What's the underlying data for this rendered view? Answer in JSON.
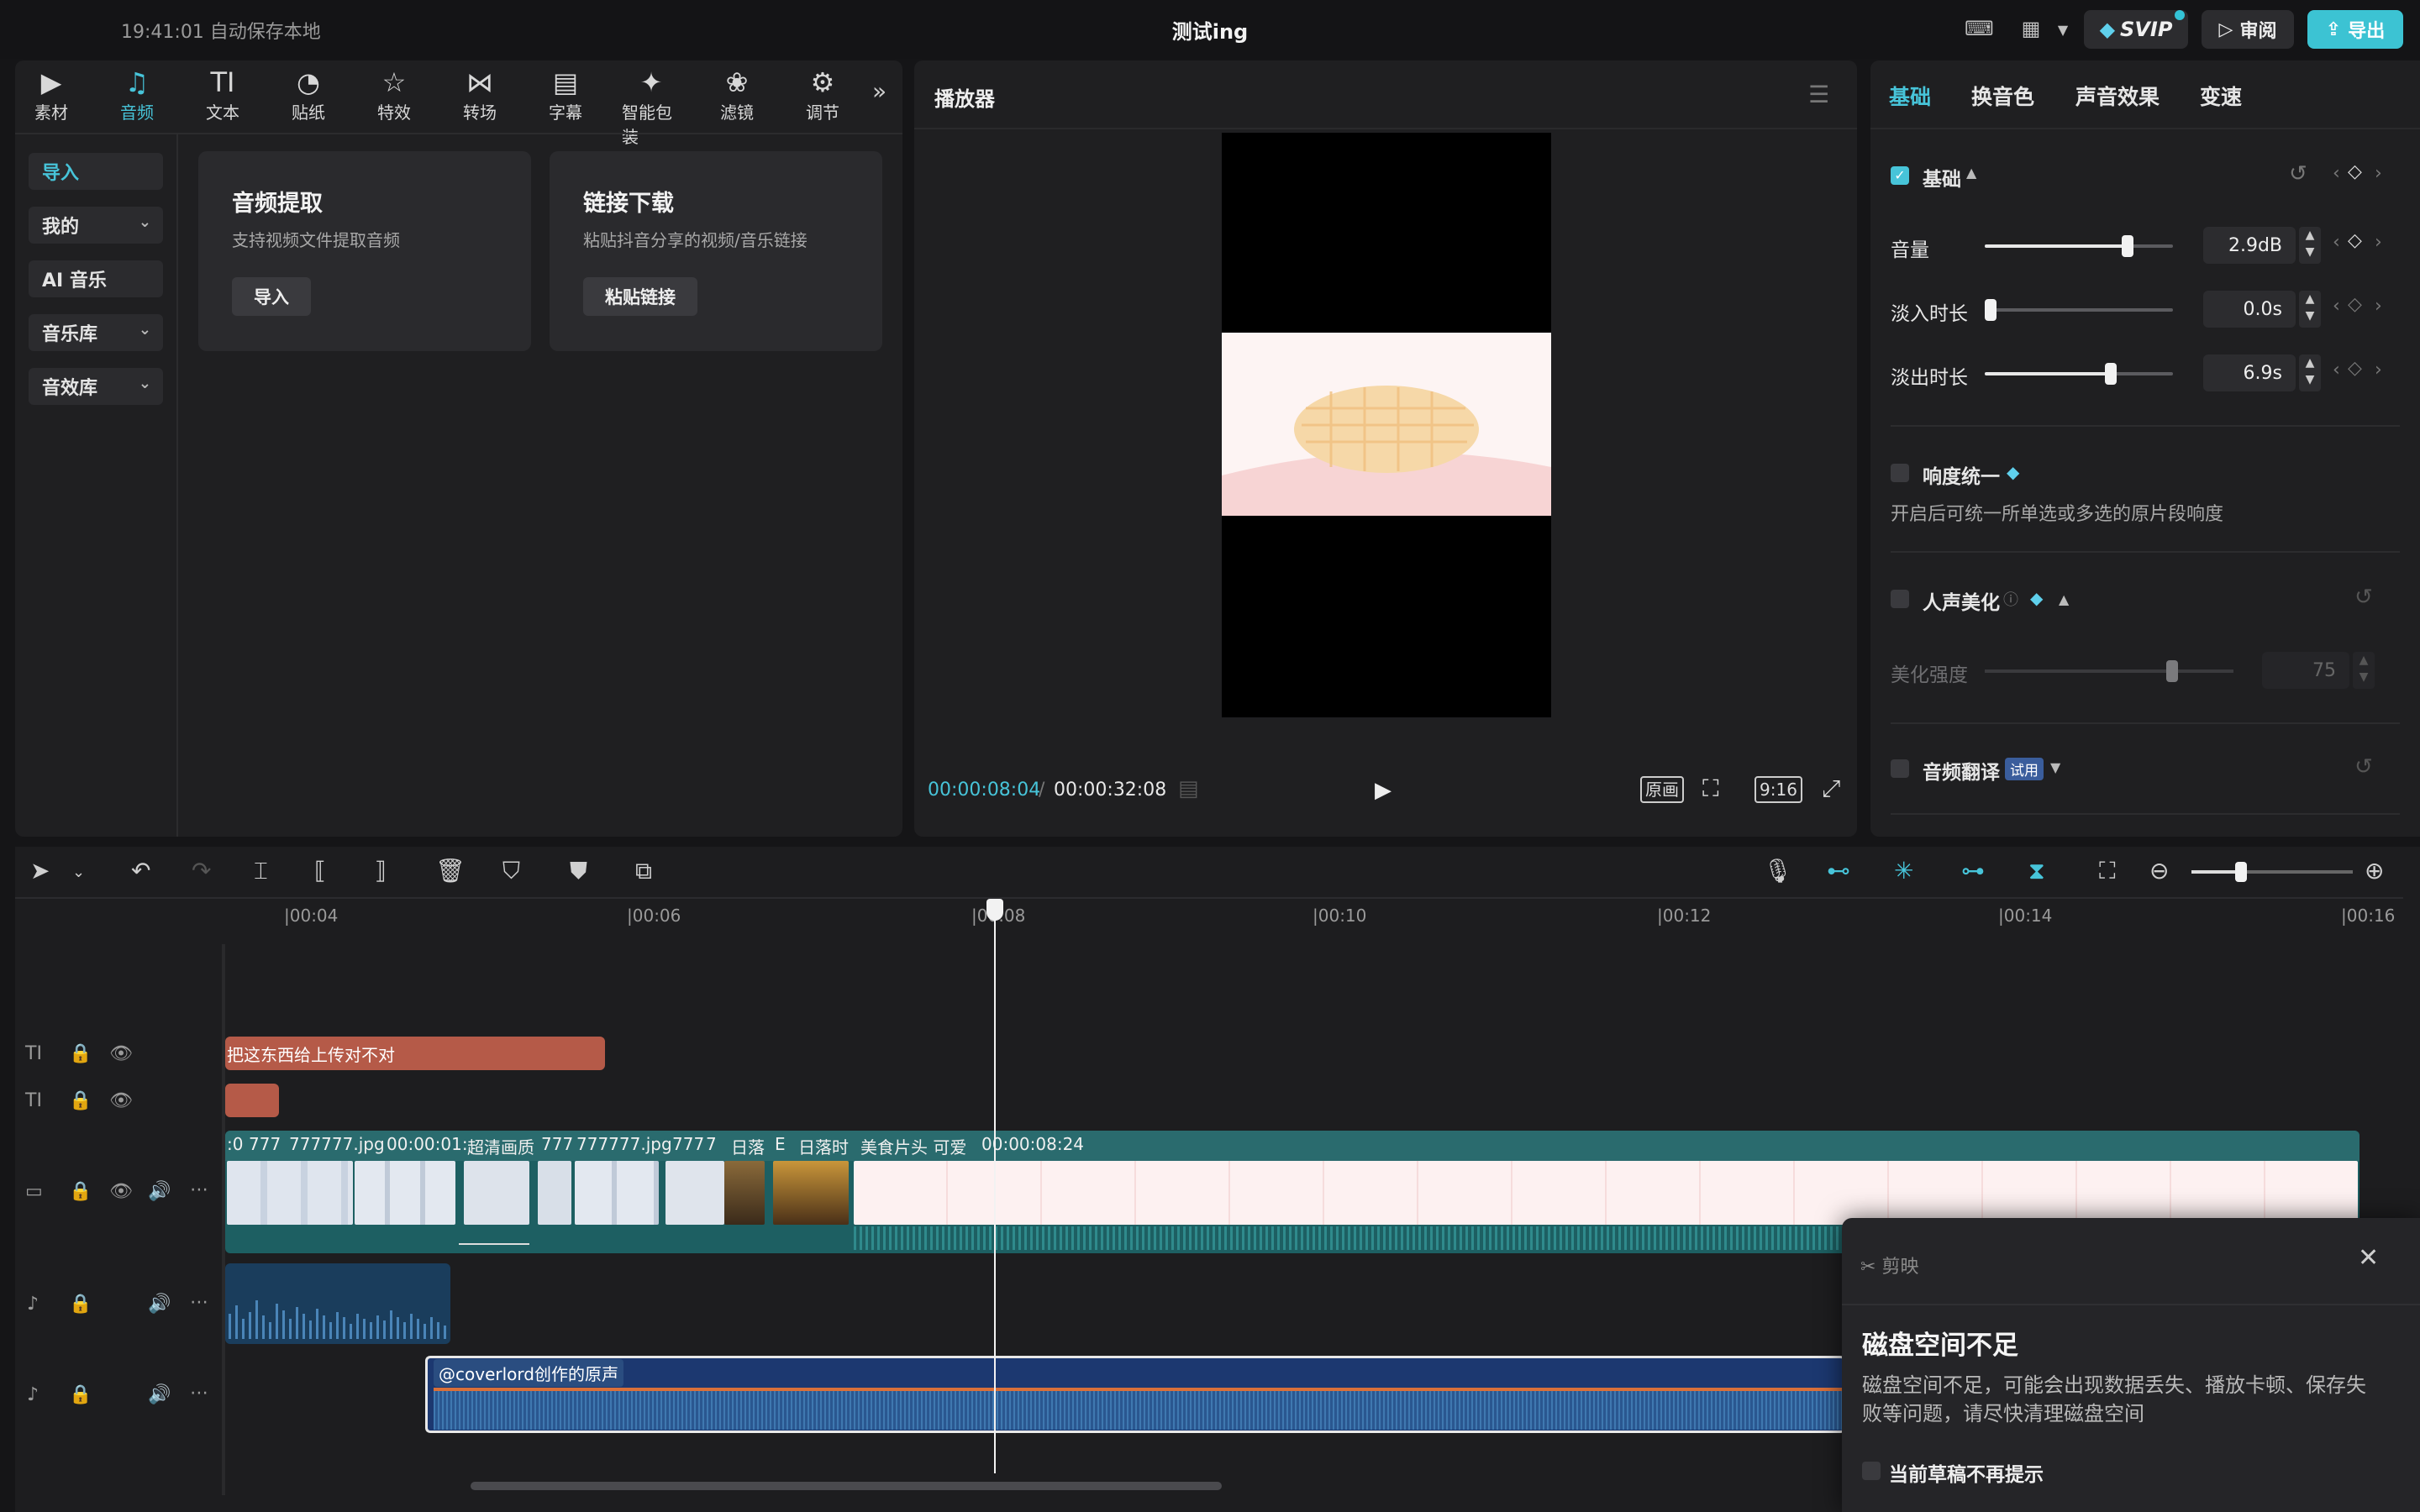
{
  "titlebar": {
    "autosave": "19:41:01 自动保存本地",
    "title": "测试ing",
    "svip_label": "SVIP",
    "review_label": "审阅",
    "export_label": "导出"
  },
  "tool_tabs": [
    {
      "label": "素材",
      "icon": "play-square-icon"
    },
    {
      "label": "音频",
      "icon": "music-note-icon"
    },
    {
      "label": "文本",
      "icon": "text-icon"
    },
    {
      "label": "贴纸",
      "icon": "sticker-icon"
    },
    {
      "label": "特效",
      "icon": "star-icon"
    },
    {
      "label": "转场",
      "icon": "transition-icon"
    },
    {
      "label": "字幕",
      "icon": "subtitle-icon"
    },
    {
      "label": "智能包装",
      "icon": "sparkle-icon"
    },
    {
      "label": "滤镜",
      "icon": "filter-icon"
    },
    {
      "label": "调节",
      "icon": "adjust-icon"
    }
  ],
  "sidebar": {
    "import": "导入",
    "mine": "我的",
    "ai_music": "AI 音乐",
    "music_lib": "音乐库",
    "sfx_lib": "音效库"
  },
  "cards": {
    "extract_title": "音频提取",
    "extract_desc": "支持视频文件提取音频",
    "extract_btn": "导入",
    "link_title": "链接下载",
    "link_desc": "粘贴抖音分享的视频/音乐链接",
    "link_btn": "粘贴链接"
  },
  "player": {
    "title": "播放器",
    "time_current": "00:00:08:04",
    "time_sep": "/",
    "time_total": "00:00:32:08",
    "original_label": "原画",
    "ratio_label": "9:16"
  },
  "right_panel": {
    "tabs": [
      "基础",
      "换音色",
      "声音效果",
      "变速"
    ],
    "basic_section": "基础",
    "volume_label": "音量",
    "volume_value": "2.9dB",
    "volume_level": 0.76,
    "fadein_label": "淡入时长",
    "fadein_value": "0.0s",
    "fadein_level": 0.0,
    "fadeout_label": "淡出时长",
    "fadeout_value": "6.9s",
    "fadeout_level": 0.67,
    "loudness_label": "响度统一",
    "loudness_desc": "开启后可统一所单选或多选的原片段响度",
    "voice_label": "人声美化",
    "strength_label": "美化强度",
    "strength_value": "75",
    "translate_label": "音频翻译",
    "trial_badge": "试用"
  },
  "timeline": {
    "ticks": [
      "|00:04",
      "|00:06",
      "|00:08",
      "|00:10",
      "|00:12",
      "|00:14",
      "|00:16"
    ],
    "text_clip": "把这东西给上传对不对",
    "main_labels": [
      ":0",
      "777",
      "777777.jpg",
      "00:00:01:",
      "超清画质",
      "777",
      "777777.jpg",
      "777",
      "7",
      "日落",
      "E",
      "日落时",
      "美食片头 可爱",
      "00:00:08:24"
    ],
    "audio2_label": "@coverlord创作的原声"
  },
  "dialog": {
    "brand": "剪映",
    "title": "磁盘空间不足",
    "body": "磁盘空间不足，可能会出现数据丢失、播放卡顿、保存失败等问题，请尽快清理磁盘空间",
    "checkbox_label": "当前草稿不再提示"
  },
  "colors": {
    "accent": "#47c4d9",
    "text_clip": "#b55a48",
    "main_track": "#1d5f62",
    "audio_track": "#1c3870"
  }
}
